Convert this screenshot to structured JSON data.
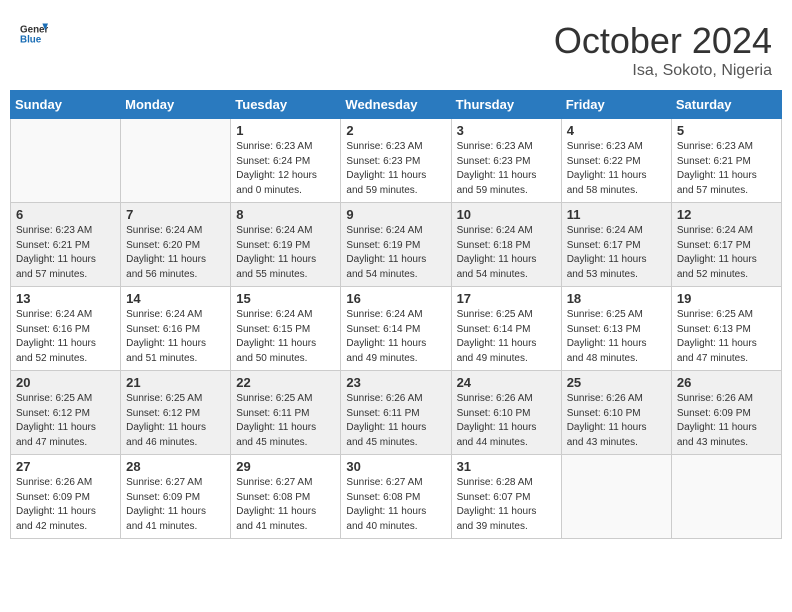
{
  "logo": {
    "line1": "General",
    "line2": "Blue"
  },
  "title": "October 2024",
  "subtitle": "Isa, Sokoto, Nigeria",
  "weekdays": [
    "Sunday",
    "Monday",
    "Tuesday",
    "Wednesday",
    "Thursday",
    "Friday",
    "Saturday"
  ],
  "weeks": [
    [
      {
        "day": "",
        "sunrise": "",
        "sunset": "",
        "daylight": ""
      },
      {
        "day": "",
        "sunrise": "",
        "sunset": "",
        "daylight": ""
      },
      {
        "day": "1",
        "sunrise": "Sunrise: 6:23 AM",
        "sunset": "Sunset: 6:24 PM",
        "daylight": "Daylight: 12 hours and 0 minutes."
      },
      {
        "day": "2",
        "sunrise": "Sunrise: 6:23 AM",
        "sunset": "Sunset: 6:23 PM",
        "daylight": "Daylight: 11 hours and 59 minutes."
      },
      {
        "day": "3",
        "sunrise": "Sunrise: 6:23 AM",
        "sunset": "Sunset: 6:23 PM",
        "daylight": "Daylight: 11 hours and 59 minutes."
      },
      {
        "day": "4",
        "sunrise": "Sunrise: 6:23 AM",
        "sunset": "Sunset: 6:22 PM",
        "daylight": "Daylight: 11 hours and 58 minutes."
      },
      {
        "day": "5",
        "sunrise": "Sunrise: 6:23 AM",
        "sunset": "Sunset: 6:21 PM",
        "daylight": "Daylight: 11 hours and 57 minutes."
      }
    ],
    [
      {
        "day": "6",
        "sunrise": "Sunrise: 6:23 AM",
        "sunset": "Sunset: 6:21 PM",
        "daylight": "Daylight: 11 hours and 57 minutes."
      },
      {
        "day": "7",
        "sunrise": "Sunrise: 6:24 AM",
        "sunset": "Sunset: 6:20 PM",
        "daylight": "Daylight: 11 hours and 56 minutes."
      },
      {
        "day": "8",
        "sunrise": "Sunrise: 6:24 AM",
        "sunset": "Sunset: 6:19 PM",
        "daylight": "Daylight: 11 hours and 55 minutes."
      },
      {
        "day": "9",
        "sunrise": "Sunrise: 6:24 AM",
        "sunset": "Sunset: 6:19 PM",
        "daylight": "Daylight: 11 hours and 54 minutes."
      },
      {
        "day": "10",
        "sunrise": "Sunrise: 6:24 AM",
        "sunset": "Sunset: 6:18 PM",
        "daylight": "Daylight: 11 hours and 54 minutes."
      },
      {
        "day": "11",
        "sunrise": "Sunrise: 6:24 AM",
        "sunset": "Sunset: 6:17 PM",
        "daylight": "Daylight: 11 hours and 53 minutes."
      },
      {
        "day": "12",
        "sunrise": "Sunrise: 6:24 AM",
        "sunset": "Sunset: 6:17 PM",
        "daylight": "Daylight: 11 hours and 52 minutes."
      }
    ],
    [
      {
        "day": "13",
        "sunrise": "Sunrise: 6:24 AM",
        "sunset": "Sunset: 6:16 PM",
        "daylight": "Daylight: 11 hours and 52 minutes."
      },
      {
        "day": "14",
        "sunrise": "Sunrise: 6:24 AM",
        "sunset": "Sunset: 6:16 PM",
        "daylight": "Daylight: 11 hours and 51 minutes."
      },
      {
        "day": "15",
        "sunrise": "Sunrise: 6:24 AM",
        "sunset": "Sunset: 6:15 PM",
        "daylight": "Daylight: 11 hours and 50 minutes."
      },
      {
        "day": "16",
        "sunrise": "Sunrise: 6:24 AM",
        "sunset": "Sunset: 6:14 PM",
        "daylight": "Daylight: 11 hours and 49 minutes."
      },
      {
        "day": "17",
        "sunrise": "Sunrise: 6:25 AM",
        "sunset": "Sunset: 6:14 PM",
        "daylight": "Daylight: 11 hours and 49 minutes."
      },
      {
        "day": "18",
        "sunrise": "Sunrise: 6:25 AM",
        "sunset": "Sunset: 6:13 PM",
        "daylight": "Daylight: 11 hours and 48 minutes."
      },
      {
        "day": "19",
        "sunrise": "Sunrise: 6:25 AM",
        "sunset": "Sunset: 6:13 PM",
        "daylight": "Daylight: 11 hours and 47 minutes."
      }
    ],
    [
      {
        "day": "20",
        "sunrise": "Sunrise: 6:25 AM",
        "sunset": "Sunset: 6:12 PM",
        "daylight": "Daylight: 11 hours and 47 minutes."
      },
      {
        "day": "21",
        "sunrise": "Sunrise: 6:25 AM",
        "sunset": "Sunset: 6:12 PM",
        "daylight": "Daylight: 11 hours and 46 minutes."
      },
      {
        "day": "22",
        "sunrise": "Sunrise: 6:25 AM",
        "sunset": "Sunset: 6:11 PM",
        "daylight": "Daylight: 11 hours and 45 minutes."
      },
      {
        "day": "23",
        "sunrise": "Sunrise: 6:26 AM",
        "sunset": "Sunset: 6:11 PM",
        "daylight": "Daylight: 11 hours and 45 minutes."
      },
      {
        "day": "24",
        "sunrise": "Sunrise: 6:26 AM",
        "sunset": "Sunset: 6:10 PM",
        "daylight": "Daylight: 11 hours and 44 minutes."
      },
      {
        "day": "25",
        "sunrise": "Sunrise: 6:26 AM",
        "sunset": "Sunset: 6:10 PM",
        "daylight": "Daylight: 11 hours and 43 minutes."
      },
      {
        "day": "26",
        "sunrise": "Sunrise: 6:26 AM",
        "sunset": "Sunset: 6:09 PM",
        "daylight": "Daylight: 11 hours and 43 minutes."
      }
    ],
    [
      {
        "day": "27",
        "sunrise": "Sunrise: 6:26 AM",
        "sunset": "Sunset: 6:09 PM",
        "daylight": "Daylight: 11 hours and 42 minutes."
      },
      {
        "day": "28",
        "sunrise": "Sunrise: 6:27 AM",
        "sunset": "Sunset: 6:09 PM",
        "daylight": "Daylight: 11 hours and 41 minutes."
      },
      {
        "day": "29",
        "sunrise": "Sunrise: 6:27 AM",
        "sunset": "Sunset: 6:08 PM",
        "daylight": "Daylight: 11 hours and 41 minutes."
      },
      {
        "day": "30",
        "sunrise": "Sunrise: 6:27 AM",
        "sunset": "Sunset: 6:08 PM",
        "daylight": "Daylight: 11 hours and 40 minutes."
      },
      {
        "day": "31",
        "sunrise": "Sunrise: 6:28 AM",
        "sunset": "Sunset: 6:07 PM",
        "daylight": "Daylight: 11 hours and 39 minutes."
      },
      {
        "day": "",
        "sunrise": "",
        "sunset": "",
        "daylight": ""
      },
      {
        "day": "",
        "sunrise": "",
        "sunset": "",
        "daylight": ""
      }
    ]
  ]
}
